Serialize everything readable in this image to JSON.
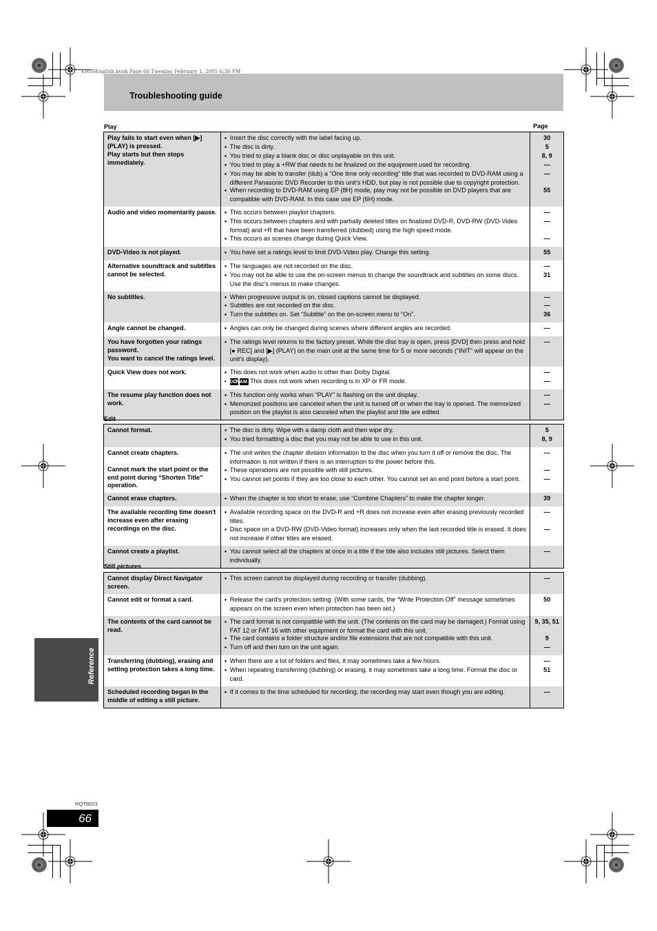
{
  "header_meta": "EH50English.book  Page 66  Tuesday, February 1, 2005  6:36 PM",
  "title": "Troubleshooting guide",
  "page_column_label": "Page",
  "sections": [
    {
      "label": "Play",
      "rows": [
        {
          "problem": [
            "Play fails to start even when [▶] (PLAY) is pressed.",
            "Play starts but then stops immediately."
          ],
          "solutions": [
            {
              "text": "Insert the disc correctly with the label facing up.",
              "page": "30"
            },
            {
              "text": "The disc is dirty.",
              "page": "5"
            },
            {
              "text": "You tried to play a blank disc or disc unplayable on this unit.",
              "page": "8, 9"
            },
            {
              "text": "You tried to play a +RW that needs to be finalized on the equipment used for recording.",
              "page": "—"
            },
            {
              "text": "You may be able to transfer (dub) a “One time only recording” title that was recorded to DVD-RAM using a different Panasonic DVD Recorder to this unit's HDD, but play is not possible due to copyright protection.",
              "page": "—"
            },
            {
              "text": "When recording to DVD-RAM using EP (8H) mode, play may not be possible on DVD players that are compatible with DVD-RAM. In this case use EP (6H) mode.",
              "page": "55"
            }
          ]
        },
        {
          "problem": [
            "Audio and video momentarily pause."
          ],
          "solutions": [
            {
              "text": "This occurs between playlist chapters.",
              "page": "—"
            },
            {
              "text": "This occurs between chapters and with partially deleted titles on finalized DVD-R, DVD-RW (DVD-Video format) and +R that have been transferred (dubbed) using the high speed mode.",
              "page": "—"
            },
            {
              "text": "This occurs as scenes change during Quick View.",
              "page": "—"
            }
          ]
        },
        {
          "problem": [
            "DVD-Video is not played."
          ],
          "solutions": [
            {
              "text": "You have set a ratings level to limit DVD-Video play. Change this setting.",
              "page": "55"
            }
          ]
        },
        {
          "problem": [
            "Alternative soundtrack and subtitles cannot be selected."
          ],
          "solutions": [
            {
              "text": "The languages are not recorded on the disc.",
              "page": "—"
            },
            {
              "text": "You may not be able to use the on-screen menus to change the soundtrack and subtitles on some discs. Use the disc's menus to make changes.",
              "page": "31"
            }
          ]
        },
        {
          "problem": [
            "No subtitles."
          ],
          "solutions": [
            {
              "text": "When progressive output is on, closed captions cannot be displayed.",
              "page": "—"
            },
            {
              "text": "Subtitles are not recorded on the disc.",
              "page": "—"
            },
            {
              "text": "Turn the subtitles on. Set “Subtitle” on the on-screen menu to “On”.",
              "page": "36"
            }
          ]
        },
        {
          "problem": [
            "Angle cannot be changed."
          ],
          "solutions": [
            {
              "text": "Angles can only be changed during scenes where different angles are recorded.",
              "page": "—"
            }
          ]
        },
        {
          "problem": [
            "You have forgotten your ratings password.",
            "You want to cancel the ratings level."
          ],
          "solutions": [
            {
              "text": "The ratings level returns to the factory preset. While the disc tray is open, press [DVD] then press and hold [● REC] and [▶] (PLAY) on the main unit at the same time for 5 or more seconds (“INIT” will appear on the unit's display).",
              "page": "—"
            }
          ]
        },
        {
          "problem": [
            "Quick View does not work."
          ],
          "solutions": [
            {
              "text": "This does not work when audio is other than Dolby Digital.",
              "page": "—"
            },
            {
              "tags": [
                "HDD",
                "RAM"
              ],
              "text": "This does not work when recording is in XP or FR mode.",
              "page": "—"
            }
          ]
        },
        {
          "problem": [
            "The resume play function does not work."
          ],
          "solutions": [
            {
              "text": "This function only works when “PLAY” is flashing on the unit display.",
              "page": "—"
            },
            {
              "text": "Memorized positions are canceled when the unit is turned off or when the tray is opened. The memorized position on the playlist is also canceled when the playlist and title are edited.",
              "page": "—"
            }
          ]
        }
      ]
    },
    {
      "label": "Edit",
      "rows": [
        {
          "problem": [
            "Cannot format."
          ],
          "solutions": [
            {
              "text": "The disc is dirty. Wipe with a damp cloth and then wipe dry.",
              "page": "5"
            },
            {
              "text": "You tried formatting a disc that you may not be able to use in this unit.",
              "page": "8, 9"
            }
          ]
        },
        {
          "problem": [
            "Cannot create chapters.",
            "",
            "Cannot mark the start point or the end point during “Shorten Title” operation."
          ],
          "solutions": [
            {
              "text": "The unit writes the chapter division information to the disc when you turn it off or remove the disc. The information is not written if there is an interruption to the power before this.",
              "page": "—"
            },
            {
              "text": "These operations are not possible with still pictures.",
              "page": "—"
            },
            {
              "text": "You cannot set points if they are too close to each other. You cannot set an end point before a start point.",
              "page": "—"
            }
          ]
        },
        {
          "problem": [
            "Cannot erase chapters."
          ],
          "solutions": [
            {
              "text": "When the chapter is too short to erase, use “Combine Chapters” to make the chapter longer.",
              "page": "39"
            }
          ]
        },
        {
          "problem": [
            "The available recording time doesn't increase even after erasing recordings on the disc."
          ],
          "solutions": [
            {
              "text": "Available recording space on the DVD-R and +R does not increase even after erasing previously recorded titles.",
              "page": "—"
            },
            {
              "text": "Disc space on a DVD-RW (DVD-Video format) increases only when the last recorded title is erased. It does not increase if other titles are erased.",
              "page": "—"
            }
          ]
        },
        {
          "problem": [
            "Cannot create a playlist."
          ],
          "solutions": [
            {
              "text": "You cannot select all the chapters at once in a title if the title also includes still pictures. Select them individually.",
              "page": "—"
            }
          ]
        }
      ]
    },
    {
      "label": "Still pictures",
      "rows": [
        {
          "problem": [
            "Cannot display Direct Navigator screen."
          ],
          "solutions": [
            {
              "text": "This screen cannot be displayed during recording or transfer (dubbing).",
              "page": "—"
            }
          ]
        },
        {
          "problem": [
            "Cannot edit or format a card."
          ],
          "solutions": [
            {
              "text": "Release the card's protection setting. (With some cards, the “Write Protection Off” message sometimes appears on the screen even when protection has been set.)",
              "page": "50"
            }
          ]
        },
        {
          "problem": [
            "The contents of the card cannot be read."
          ],
          "solutions": [
            {
              "text": "The card format is not compatible with the unit. (The contents on the card may be damaged.) Format using FAT 12 or FAT 16 with other equipment or format the card with this unit.",
              "page": "9, 35, 51"
            },
            {
              "text": "The card contains a folder structure and/or file extensions that are not compatible with this unit.",
              "page": "9"
            },
            {
              "text": "Turn off and then turn on the unit again.",
              "page": "—"
            }
          ]
        },
        {
          "problem": [
            "Transferring (dubbing), erasing and setting protection takes a long time."
          ],
          "solutions": [
            {
              "text": "When there are a lot of folders and files, it may sometimes take a few hours.",
              "page": "—"
            },
            {
              "text": "When repeating transferring (dubbing) or erasing, it may sometimes take a long time. Format the disc or card.",
              "page": "51"
            }
          ]
        },
        {
          "problem": [
            "Scheduled recording began in the middle of editing a still picture."
          ],
          "solutions": [
            {
              "text": "If it comes to the time scheduled for recording, the recording may start even though you are editing.",
              "page": "—"
            }
          ]
        }
      ]
    }
  ],
  "side_tab": "Reference",
  "doc_number": "RQT8023",
  "page_number": "66"
}
